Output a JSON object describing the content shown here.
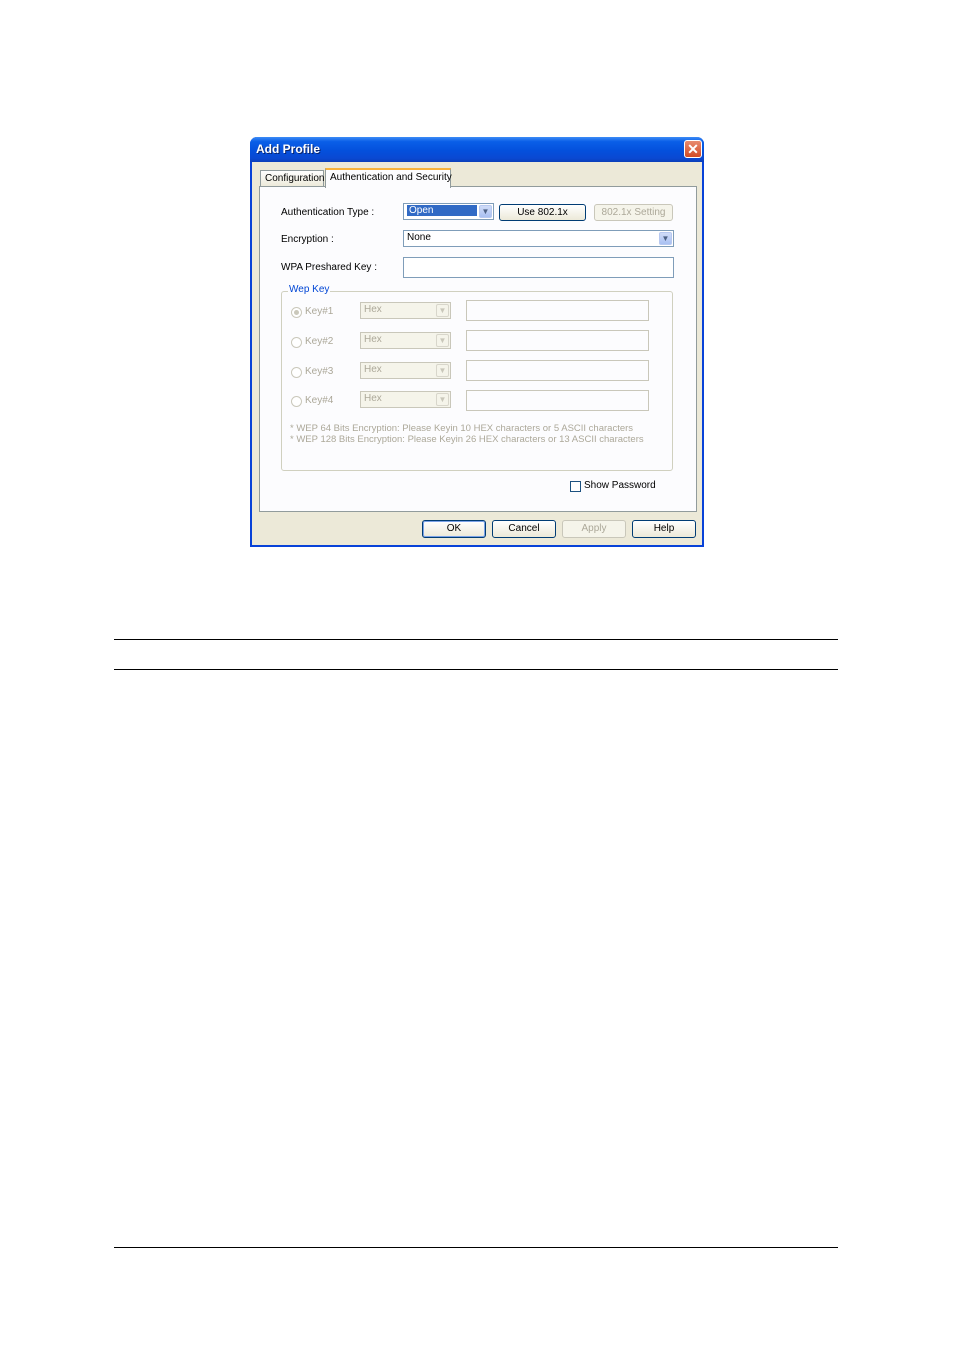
{
  "window": {
    "title": "Add Profile",
    "close_glyph": "✕"
  },
  "tabs": [
    {
      "label": "Configuration",
      "active": false
    },
    {
      "label": "Authentication and Security",
      "active": true
    }
  ],
  "auth": {
    "auth_type_label": "Authentication Type :",
    "auth_type_value": "Open",
    "use_8021x_label": "Use 802.1x",
    "setting_8021x_label": "802.1x Setting",
    "encryption_label": "Encryption :",
    "encryption_value": "None",
    "wpa_label": "WPA Preshared Key :",
    "wpa_value": ""
  },
  "wep": {
    "group_title": "Wep Key",
    "keys": [
      {
        "label": "Key#1",
        "format": "Hex",
        "checked": true
      },
      {
        "label": "Key#2",
        "format": "Hex",
        "checked": false
      },
      {
        "label": "Key#3",
        "format": "Hex",
        "checked": false
      },
      {
        "label": "Key#4",
        "format": "Hex",
        "checked": false
      }
    ],
    "note1": "* WEP 64 Bits Encryption:  Please Keyin 10 HEX characters or 5 ASCII characters",
    "note2": "* WEP 128 Bits Encryption:  Please Keyin 26 HEX characters or 13 ASCII characters"
  },
  "show_password_label": "Show Password",
  "buttons": {
    "ok": "OK",
    "cancel": "Cancel",
    "apply": "Apply",
    "help": "Help"
  },
  "colors": {
    "title_bar": "#0450dc",
    "accent": "#316ac5",
    "disabled_text": "#aca899"
  },
  "icons": {
    "dropdown": "▼"
  }
}
